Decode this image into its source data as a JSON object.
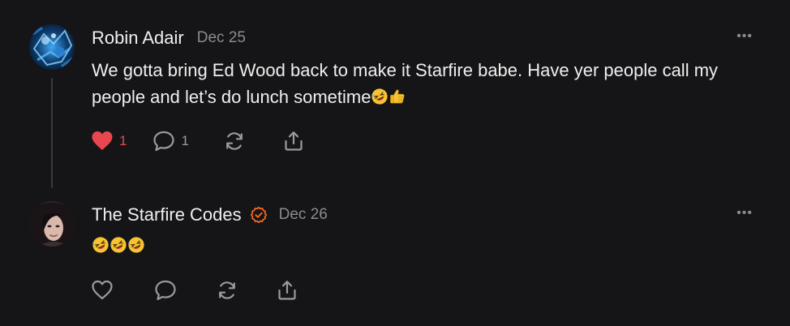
{
  "posts": [
    {
      "author": "Robin Adair",
      "date": "Dec 25",
      "more_label": "•••",
      "body_text": "We gotta bring Ed Wood back to make it Starfire babe. Have yer people call my people and let’s do lunch sometime",
      "trailing_emojis": [
        "rolling-on-floor-laughing-emoji",
        "thumbs-up-emoji"
      ],
      "like_count": "1",
      "liked": true,
      "reply_count": "1",
      "colors": {
        "like": "#e8474f"
      }
    },
    {
      "author": "The Starfire Codes",
      "date": "Dec 26",
      "more_label": "•••",
      "verified": true,
      "body_emojis": [
        "rolling-on-floor-laughing-emoji",
        "rolling-on-floor-laughing-emoji",
        "rolling-on-floor-laughing-emoji"
      ],
      "colors": {
        "verified": "#ff6a1f"
      }
    }
  ],
  "theme": {
    "background": "#151517",
    "text": "#efefef",
    "muted": "#8a8a90"
  }
}
